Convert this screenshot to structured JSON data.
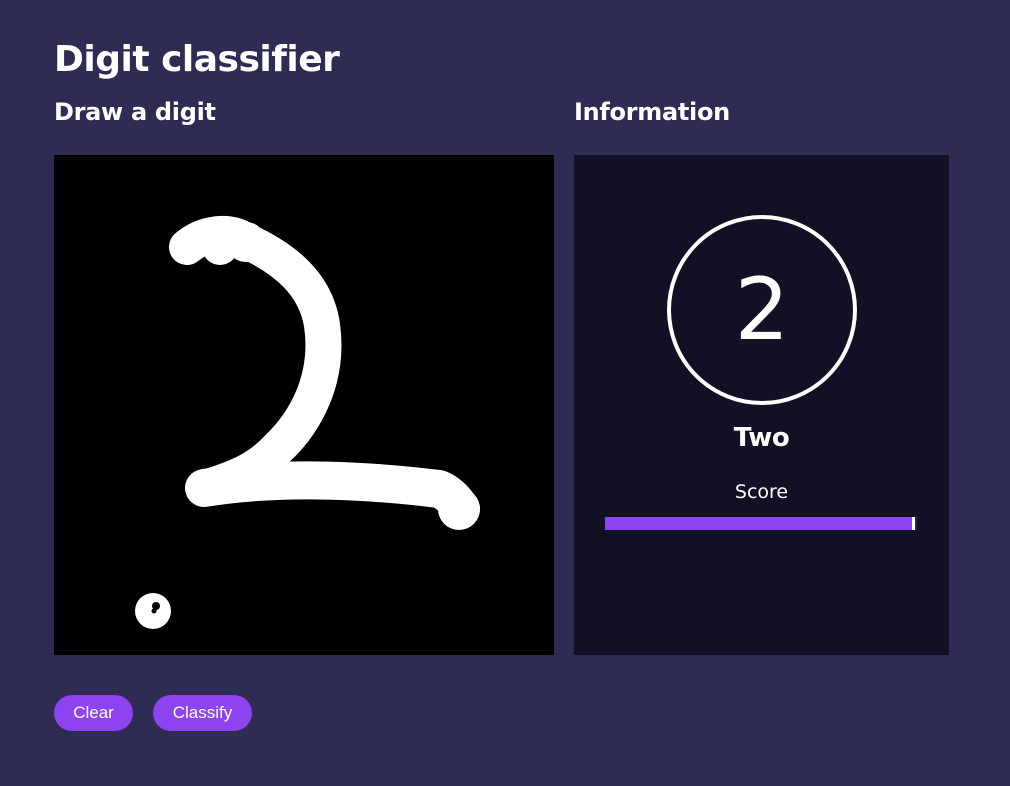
{
  "page": {
    "title": "Digit classifier"
  },
  "draw_section": {
    "title": "Draw a digit"
  },
  "info_section": {
    "title": "Information",
    "prediction_digit": "2",
    "prediction_label": "Two",
    "score_label": "Score",
    "score_fraction": 0.995
  },
  "buttons": {
    "clear_label": "Clear",
    "classify_label": "Classify"
  },
  "colors": {
    "background": "#2f2c53",
    "panel": "#111025",
    "accent": "#8e43f0",
    "text": "#ffffff"
  }
}
